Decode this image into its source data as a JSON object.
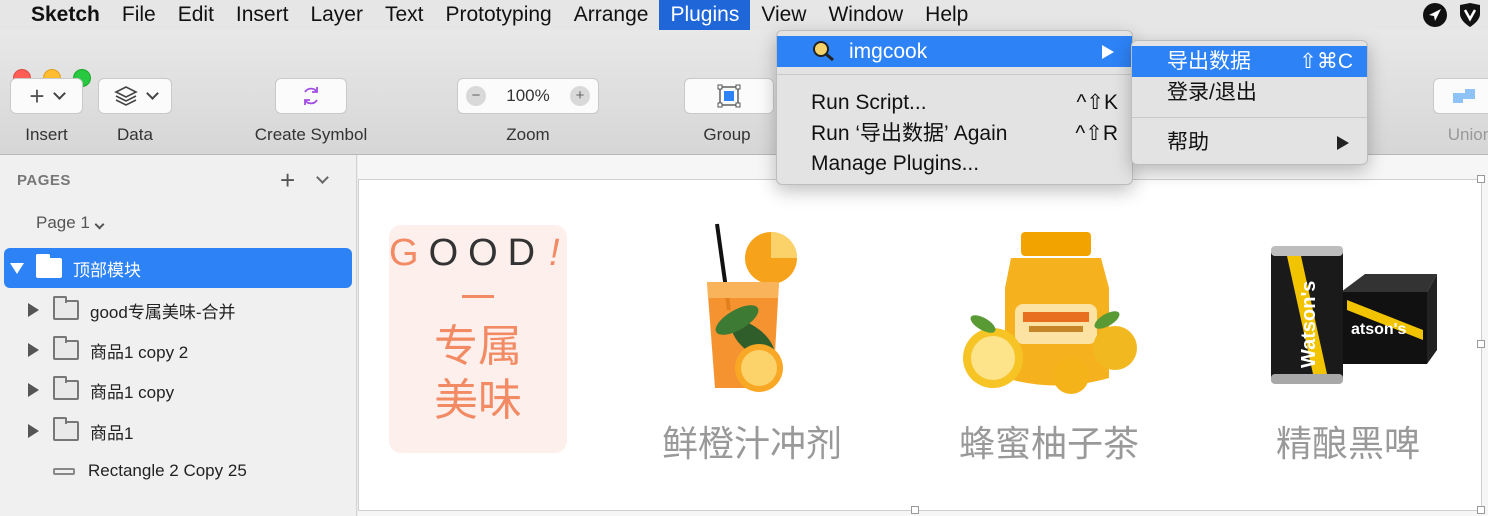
{
  "menubar": {
    "app": "Sketch",
    "items": [
      "File",
      "Edit",
      "Insert",
      "Layer",
      "Text",
      "Prototyping",
      "Arrange",
      "Plugins",
      "View",
      "Window",
      "Help"
    ],
    "active": "Plugins",
    "status_icons": [
      "location-arrow-icon",
      "shield-icon"
    ]
  },
  "toolbar": {
    "insert_label": "Insert",
    "data_label": "Data",
    "create_symbol_label": "Create Symbol",
    "zoom_label": "Zoom",
    "zoom_value": "100%",
    "group_label": "Group",
    "union_label": "Union"
  },
  "sidebar": {
    "pages_header": "PAGES",
    "current_page": "Page 1",
    "layers": [
      {
        "label": "顶部模块",
        "selected": true,
        "expanded": true
      },
      {
        "label": "good专属美味-合并"
      },
      {
        "label": "商品1 copy 2"
      },
      {
        "label": "商品1 copy"
      },
      {
        "label": "商品1"
      },
      {
        "label": "Rectangle 2 Copy 25"
      }
    ]
  },
  "canvas": {
    "good_word": "GOOD",
    "good_exclaim": "!",
    "good_text_line1": "专属",
    "good_text_line2": "美味",
    "products": [
      {
        "name": "鲜橙汁冲剂",
        "icon": "orange-juice-image"
      },
      {
        "name": "蜂蜜柚子茶",
        "icon": "honey-citron-tea-image"
      },
      {
        "name": "精酿黑啤",
        "icon": "watsons-beer-image"
      }
    ]
  },
  "plugins_menu": {
    "imgcook": "imgcook",
    "run_script": "Run Script...",
    "run_script_shortcut": "^⇧K",
    "run_again": "Run ‘导出数据’ Again",
    "run_again_shortcut": "^⇧R",
    "manage": "Manage Plugins..."
  },
  "imgcook_submenu": {
    "export": "导出数据",
    "export_shortcut": "⇧⌘C",
    "login": "登录/退出",
    "help": "帮助"
  },
  "colors": {
    "accent": "#2d82f5",
    "menubar_active": "#1f66d9",
    "good_orange": "#f28a64"
  }
}
